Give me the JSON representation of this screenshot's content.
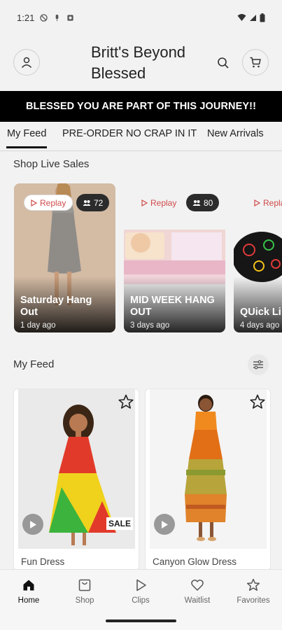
{
  "status": {
    "time": "1:21"
  },
  "header": {
    "title": "Britt's Beyond Blessed"
  },
  "banner": {
    "text": "BLESSED YOU ARE PART OF THIS JOURNEY!!"
  },
  "tabs": [
    {
      "label": "My Feed"
    },
    {
      "label": "PRE-ORDER NO CRAP IN IT"
    },
    {
      "label": "New Arrivals"
    }
  ],
  "live_sales": {
    "title": "Shop Live Sales",
    "cards": [
      {
        "replay": "Replay",
        "viewers": "72",
        "title": "Saturday Hang Out",
        "time": "1 day ago"
      },
      {
        "replay": "Replay",
        "viewers": "80",
        "title": "MID WEEK HANG OUT",
        "time": "3 days ago"
      },
      {
        "replay": "Repla",
        "title": "QUick Li",
        "time": "4 days ago"
      }
    ]
  },
  "feed": {
    "title": "My Feed",
    "products": [
      {
        "name": "Fun Dress",
        "badge": "SALE"
      },
      {
        "name": "Canyon Glow Dress"
      }
    ]
  },
  "nav": {
    "items": [
      {
        "label": "Home",
        "icon": "home-icon"
      },
      {
        "label": "Shop",
        "icon": "shop-icon"
      },
      {
        "label": "Clips",
        "icon": "play-icon"
      },
      {
        "label": "Waitlist",
        "icon": "heart-icon"
      },
      {
        "label": "Favorites",
        "icon": "star-icon"
      }
    ]
  },
  "colors": {
    "accent": "#d04a4a",
    "banner_bg": "#000000",
    "page_bg": "#f2f2f2"
  }
}
